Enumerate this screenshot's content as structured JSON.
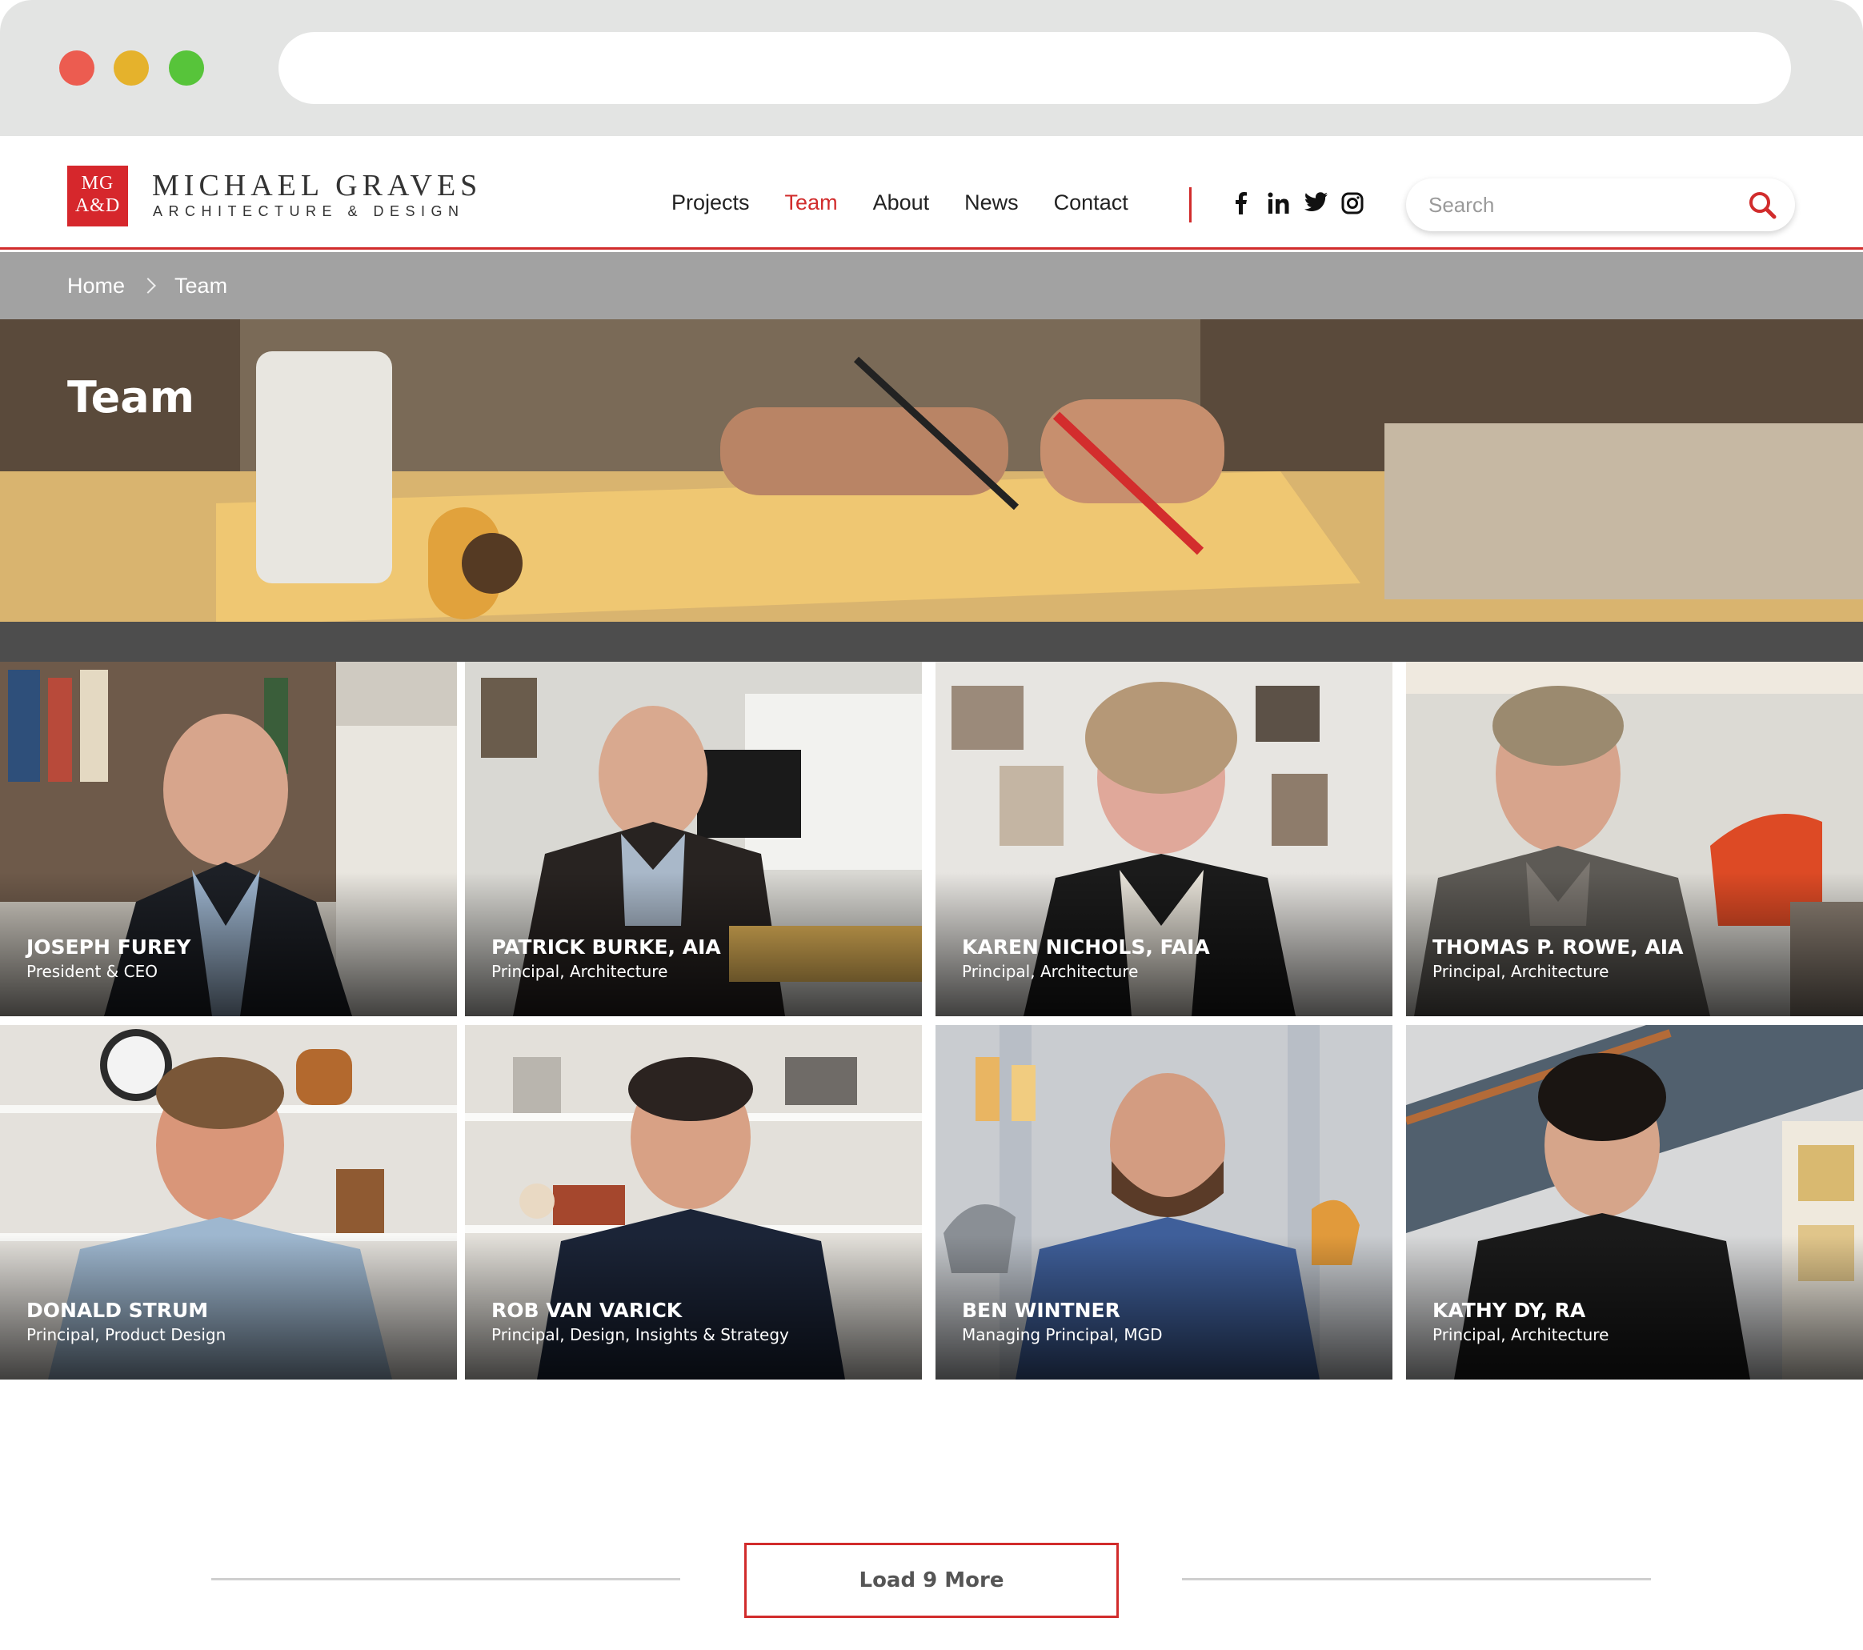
{
  "brand": {
    "mark_top": "MG",
    "mark_bottom": "A&D",
    "name": "MICHAEL GRAVES",
    "sub": "ARCHITECTURE & DESIGN"
  },
  "nav": {
    "items": [
      {
        "label": "Projects",
        "active": false
      },
      {
        "label": "Team",
        "active": true
      },
      {
        "label": "About",
        "active": false
      },
      {
        "label": "News",
        "active": false
      },
      {
        "label": "Contact",
        "active": false
      }
    ]
  },
  "social": [
    "facebook-icon",
    "linkedin-icon",
    "twitter-icon",
    "instagram-icon"
  ],
  "search": {
    "placeholder": "Search"
  },
  "breadcrumb": {
    "home": "Home",
    "current": "Team"
  },
  "hero": {
    "title": "Team"
  },
  "team": [
    {
      "name": "JOSEPH FUREY",
      "role": "President & CEO"
    },
    {
      "name": "PATRICK BURKE, AIA",
      "role": "Principal, Architecture"
    },
    {
      "name": "KAREN NICHOLS, FAIA",
      "role": "Principal, Architecture"
    },
    {
      "name": "THOMAS P. ROWE, AIA",
      "role": "Principal, Architecture"
    },
    {
      "name": "DONALD STRUM",
      "role": "Principal, Product Design"
    },
    {
      "name": "ROB VAN VARICK",
      "role": "Principal, Design, Insights & Strategy"
    },
    {
      "name": "BEN WINTNER",
      "role": "Managing Principal, MGD"
    },
    {
      "name": "KATHY DY, RA",
      "role": "Principal, Architecture"
    }
  ],
  "load_more": {
    "label": "Load 9 More"
  },
  "colors": {
    "accent": "#d12c2c",
    "breadcrumb_bg": "#a2a2a2",
    "band": "#4d4d4d"
  }
}
